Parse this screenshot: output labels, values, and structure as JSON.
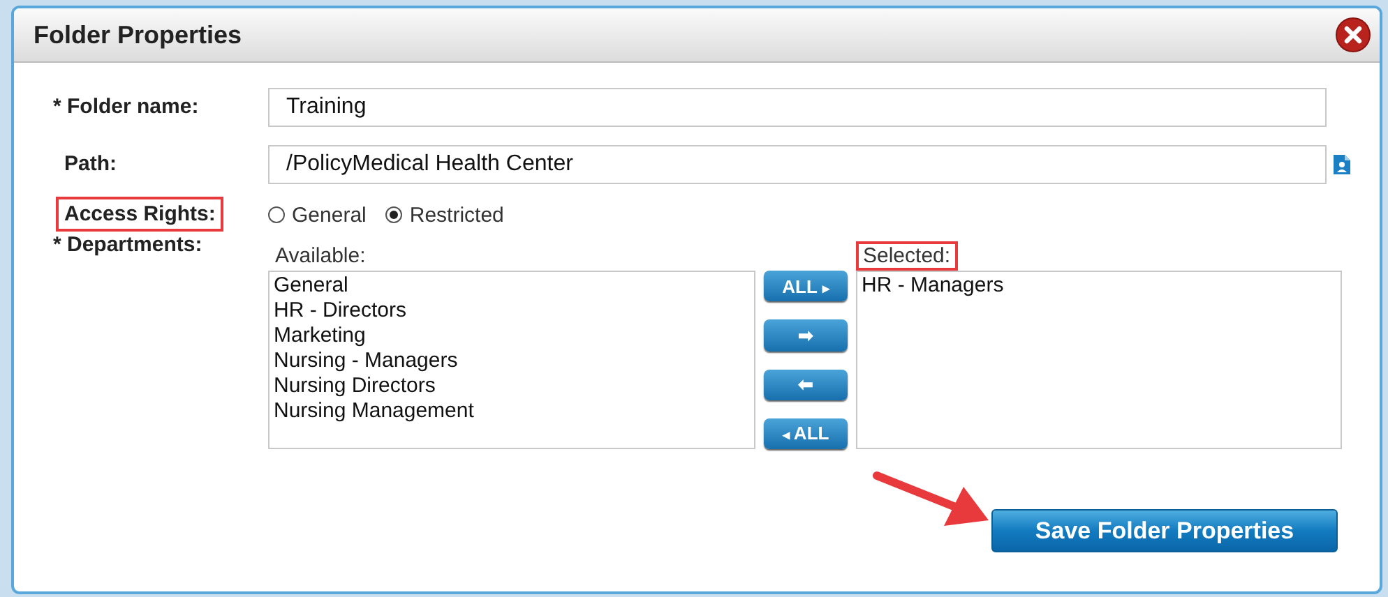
{
  "dialog": {
    "title": "Folder Properties"
  },
  "folder_name": {
    "label": "* Folder name:",
    "value": "Training",
    "highlighted": false
  },
  "path": {
    "label": "Path:",
    "value": "/PolicyMedical Health Center",
    "highlighted": false
  },
  "access_rights": {
    "label": "Access Rights:",
    "highlighted": true,
    "options": [
      {
        "label": "General",
        "selected": false
      },
      {
        "label": "Restricted",
        "selected": true
      }
    ]
  },
  "departments": {
    "label": "* Departments:",
    "highlighted": false,
    "available": {
      "label": "Available:",
      "highlighted": false,
      "items": [
        "General",
        "HR - Directors",
        "Marketing",
        "Nursing - Managers",
        "Nursing Directors",
        "Nursing Management"
      ]
    },
    "transfer_buttons": [
      {
        "kind": "all_right",
        "label": "ALL",
        "arrow": "▸"
      },
      {
        "kind": "one",
        "arrow": "➡"
      },
      {
        "kind": "one",
        "arrow": "⬅"
      },
      {
        "kind": "all_left",
        "label": "ALL",
        "arrow": "◂"
      }
    ],
    "selected": {
      "label": "Selected:",
      "highlighted": true,
      "items": [
        "HR - Managers"
      ]
    }
  },
  "save_button": {
    "label": "Save Folder Properties"
  }
}
